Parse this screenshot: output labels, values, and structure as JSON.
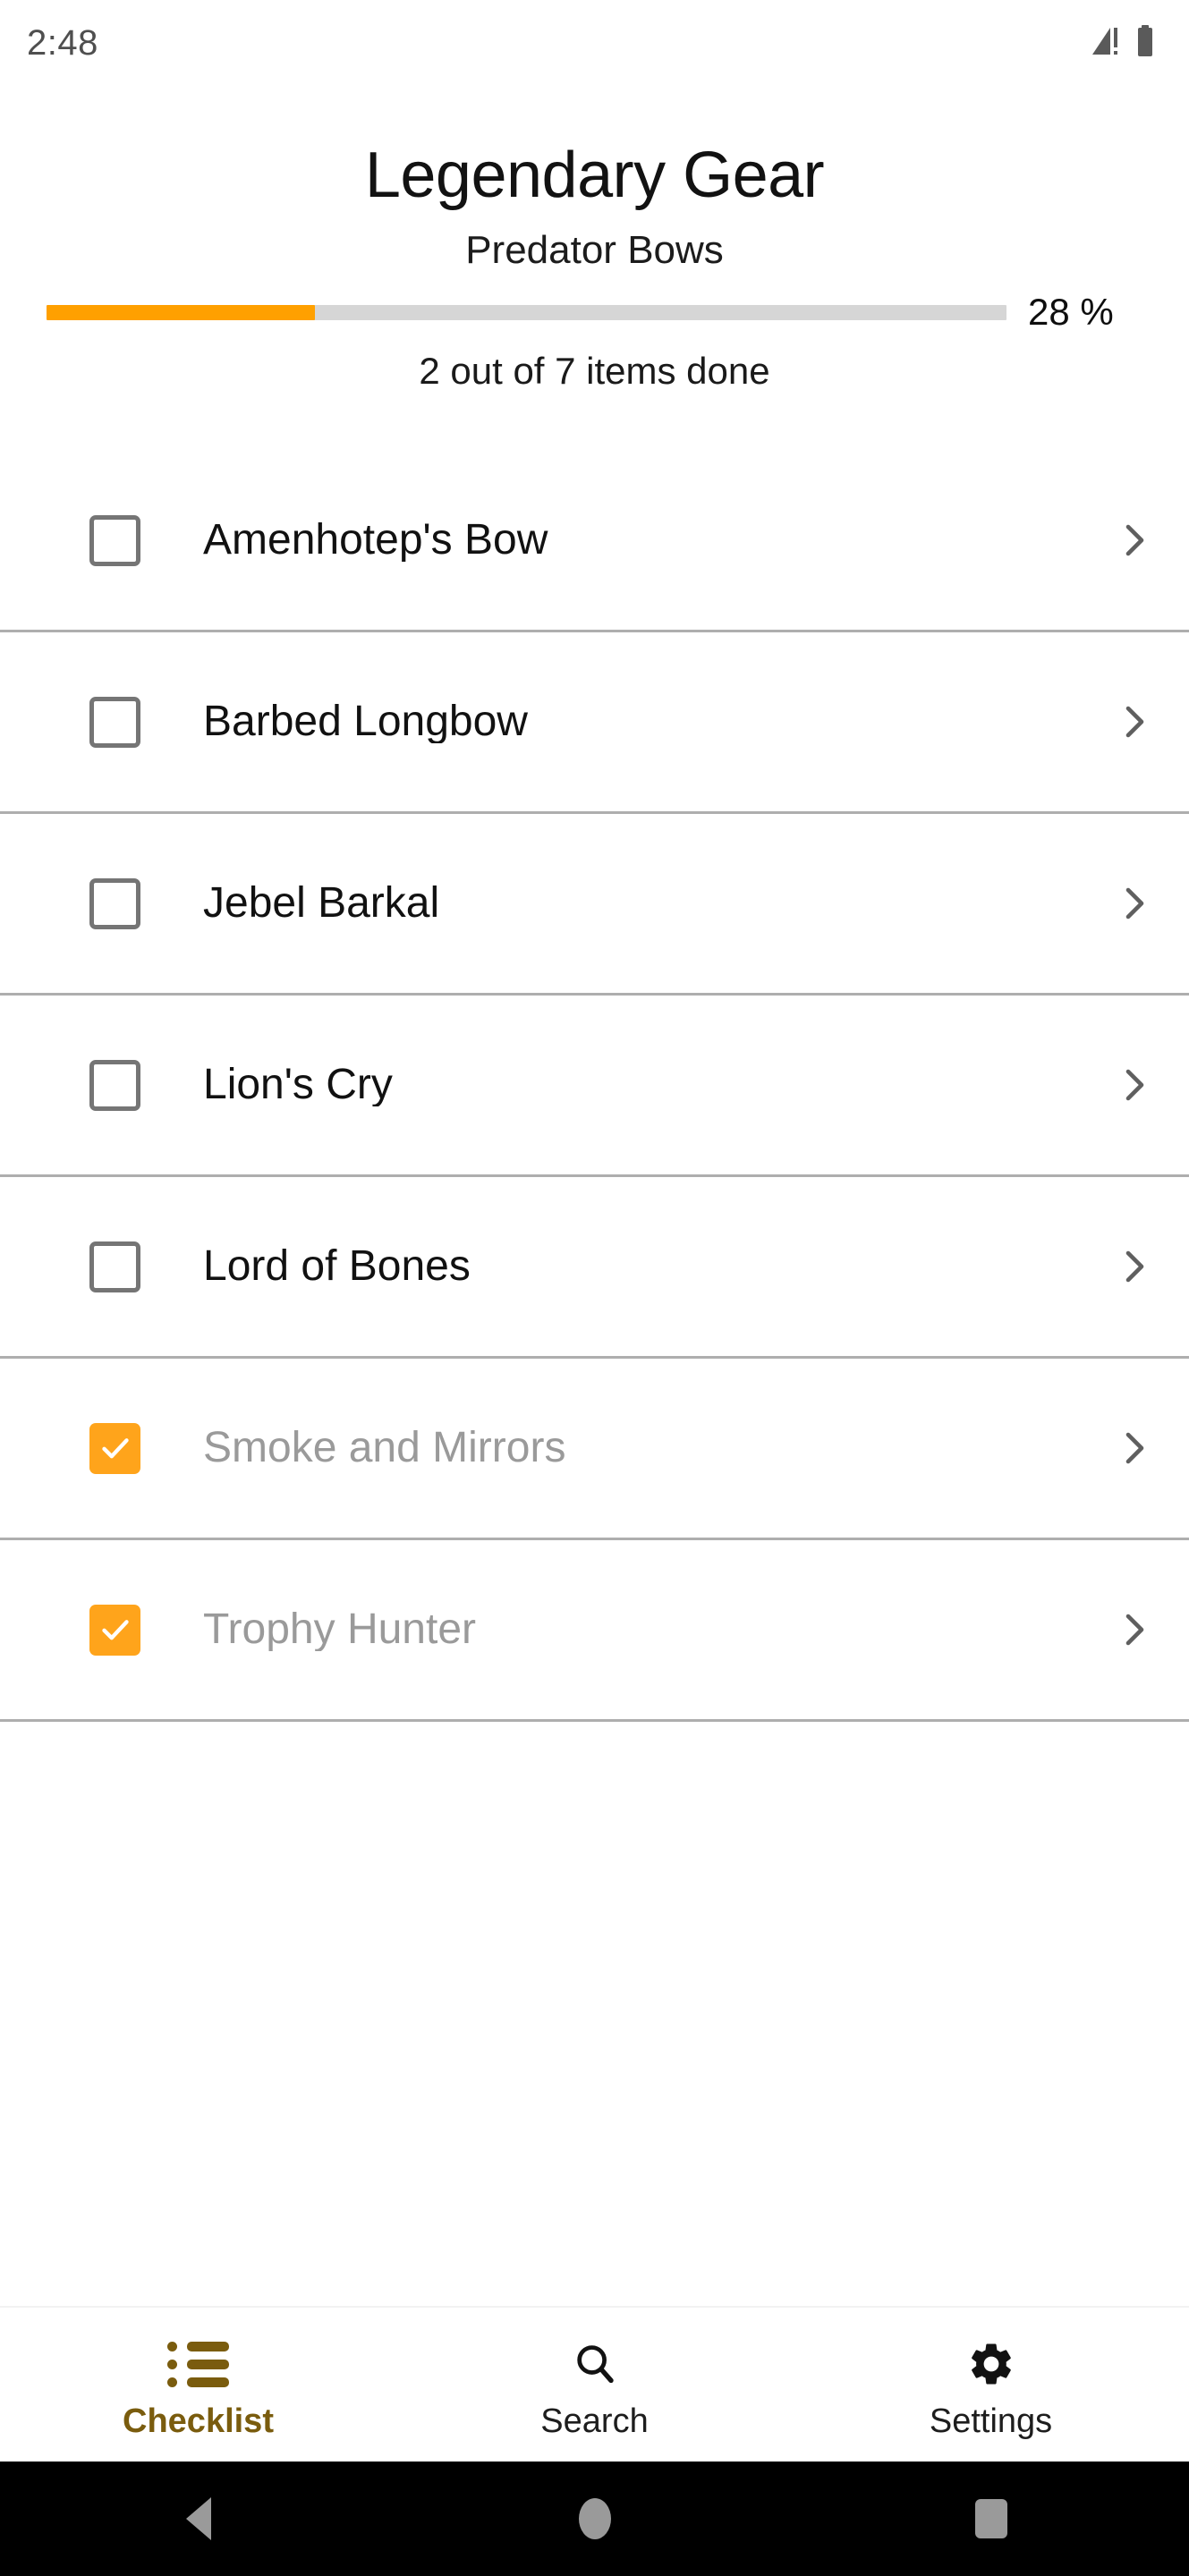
{
  "status_bar": {
    "time": "2:48",
    "signal_icon": "signal-bars-icon",
    "battery_icon": "battery-full-icon"
  },
  "header": {
    "title": "Legendary Gear",
    "subtitle": "Predator Bows"
  },
  "progress": {
    "percent_label": "28 %",
    "percent_value": 28,
    "caption": "2 out of 7 items done",
    "done_count": 2,
    "total_count": 7,
    "fill_color": "#ffa000",
    "track_color": "#d6d6d6"
  },
  "checklist": {
    "items": [
      {
        "label": "Amenhotep's Bow",
        "checked": false,
        "chevron_icon": "chevron-right-icon"
      },
      {
        "label": "Barbed Longbow",
        "checked": false,
        "chevron_icon": "chevron-right-icon"
      },
      {
        "label": "Jebel Barkal",
        "checked": false,
        "chevron_icon": "chevron-right-icon"
      },
      {
        "label": "Lion's Cry",
        "checked": false,
        "chevron_icon": "chevron-right-icon"
      },
      {
        "label": "Lord of Bones",
        "checked": false,
        "chevron_icon": "chevron-right-icon"
      },
      {
        "label": "Smoke and Mirrors",
        "checked": true,
        "chevron_icon": "chevron-right-icon"
      },
      {
        "label": "Trophy Hunter",
        "checked": true,
        "chevron_icon": "chevron-right-icon"
      }
    ],
    "checked_color": "#ffa41b",
    "unchecked_border_color": "#757575",
    "done_text_color": "#9a9a9a"
  },
  "bottom_nav": {
    "active_color": "#7a5c0e",
    "items": [
      {
        "label": "Checklist",
        "icon": "list-icon",
        "active": true
      },
      {
        "label": "Search",
        "icon": "search-icon",
        "active": false
      },
      {
        "label": "Settings",
        "icon": "gear-icon",
        "active": false
      }
    ]
  },
  "system_nav": {
    "back_icon": "triangle-back-icon",
    "home_icon": "circle-home-icon",
    "recents_icon": "square-recents-icon"
  }
}
